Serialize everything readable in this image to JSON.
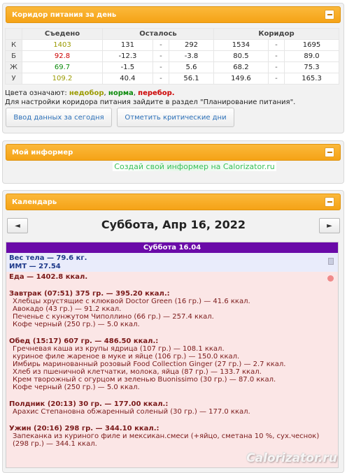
{
  "corridor": {
    "title": "Коридор питания за день",
    "headers": {
      "eaten": "Съедено",
      "left": "Осталось",
      "corridor": "Коридор"
    },
    "rows": [
      {
        "meal": "К",
        "eaten": "1403",
        "status": "under",
        "left_from": "131",
        "left_to": "292",
        "cor_from": "1534",
        "cor_to": "1695"
      },
      {
        "meal": "Б",
        "eaten": "92.8",
        "status": "over",
        "left_from": "-12.3",
        "left_to": "-3.8",
        "cor_from": "80.5",
        "cor_to": "89.0"
      },
      {
        "meal": "Ж",
        "eaten": "69.7",
        "status": "norm",
        "left_from": "-1.5",
        "left_to": "5.6",
        "cor_from": "68.2",
        "cor_to": "75.3"
      },
      {
        "meal": "У",
        "eaten": "109.2",
        "status": "under",
        "left_from": "40.4",
        "left_to": "56.1",
        "cor_from": "149.6",
        "cor_to": "165.3"
      }
    ],
    "dash": "-",
    "legend_prefix": "Цвета означают:",
    "legend_under": "недобор",
    "legend_norm": "норма",
    "legend_over": "перебор.",
    "legend_sep": ",",
    "setup_note": "Для настройки коридора питания зайдите в раздел \"Планирование питания\".",
    "btn_enter": "Ввод данных за сегодня",
    "btn_critical": "Отметить критические дни"
  },
  "informer": {
    "title": "Мой информер",
    "link": "Создай свой информер на Calorizator.ru"
  },
  "calendar": {
    "title": "Календарь",
    "date": "Суббота, Апр 16, 2022",
    "prev": "◄",
    "next": "►",
    "day_header": "Суббота 16.04",
    "weight": "Вес тела — 79.6 кг.",
    "bmi": "ИМТ — 27.54",
    "food_total": "Еда — 1402.8 ккал.",
    "meals": [
      {
        "title": "Завтрак (07:51) 375 гр. — 395.20 ккал.:",
        "items": [
          "Хлебцы хрустящие с клюквой Doctor Green (16 гр.) — 41.6 ккал.",
          "Авокадо (43 гр.) — 91.2 ккал.",
          "Печенье с кунжутом Чиполлино (66 гр.) — 257.4 ккал.",
          "Кофе черный (250 гр.) — 5.0 ккал."
        ]
      },
      {
        "title": "Обед (15:17) 607 гр. — 486.50 ккал.:",
        "items": [
          "Гречневая каша из крупы ядрица (107 гр.) — 108.1 ккал.",
          "куриное филе жареное в муке и яйце (106 гр.) — 150.0 ккал.",
          "Имбирь маринованный розовый Food Collection Ginger (27 гр.) — 2.7 ккал.",
          "Хлеб из пшеничной клетчатки, молока, яйца (87 гр.) — 133.7 ккал.",
          "Крем творожный с огурцом и зеленью Buonissimo (30 гр.) — 87.0 ккал.",
          "Кофе черный (250 гр.) — 5.0 ккал."
        ]
      },
      {
        "title": "Полдник (20:13) 30 гр. — 177.00 ккал.:",
        "items": [
          "Арахис Степановна обжаренный соленый (30 гр.) — 177.0 ккал."
        ]
      },
      {
        "title": "Ужин (20:16) 298 гр. — 344.10 ккал.:",
        "items": [
          "Запеканка из куриного филе и мексикан.смеси (+яйцо, сметана 10 %, сух.чеснок) (298 гр.) — 344.1 ккал."
        ]
      }
    ]
  },
  "watermark": "Calorizator.ru",
  "colors": {
    "under": "#9a9a00",
    "norm": "#0a8a0a",
    "over": "#cc0000",
    "accent": "#f5a316",
    "day_header": "#6a0aa8"
  },
  "icons": {
    "collapse": "minus-icon",
    "weight": "scale-icon",
    "food": "apple-icon"
  }
}
